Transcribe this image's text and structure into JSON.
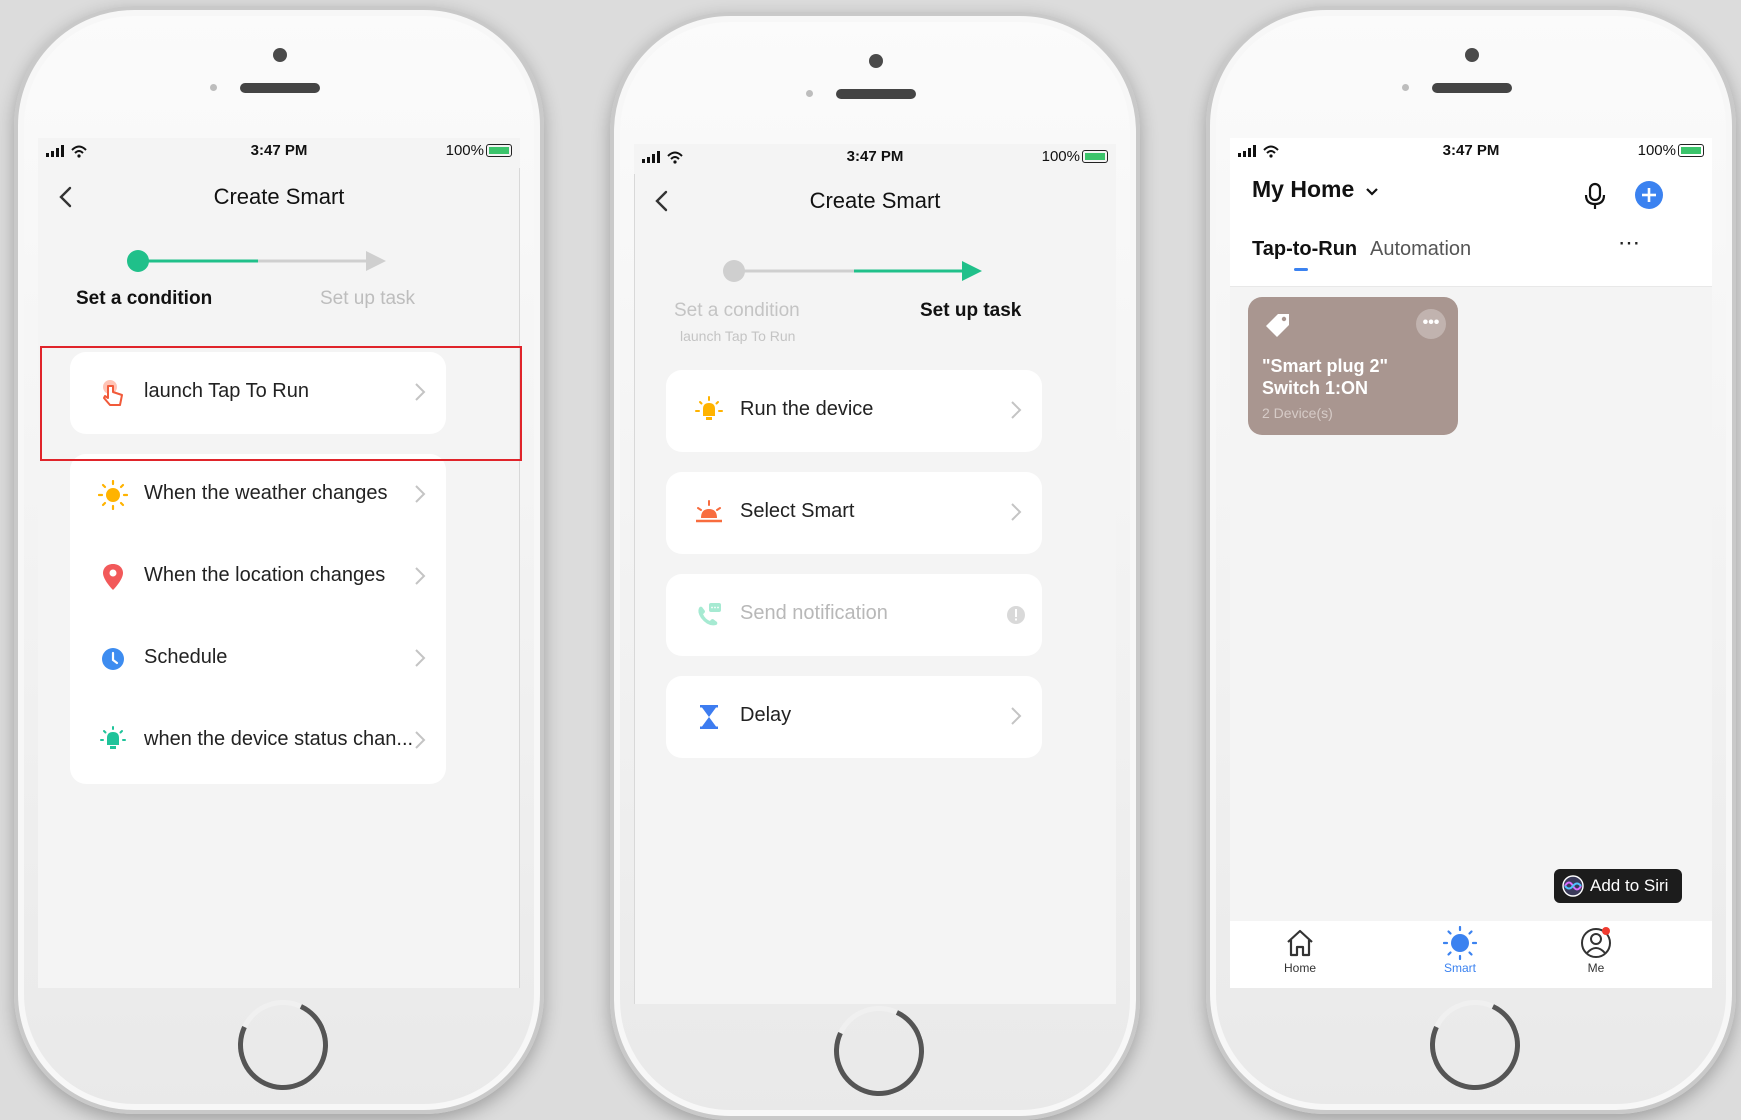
{
  "phones": [
    {
      "status": {
        "time": "3:47 PM",
        "battery": "100%"
      },
      "title": "Create Smart",
      "steps": {
        "step1": "Set a condition",
        "step2": "Set up task"
      },
      "highlighted_item": {
        "label": "launch Tap To Run",
        "icon": "tap-hand-icon"
      },
      "items": [
        {
          "label": "When the weather changes",
          "icon": "sun-icon"
        },
        {
          "label": "When the location changes",
          "icon": "location-pin-icon"
        },
        {
          "label": "Schedule",
          "icon": "clock-icon"
        },
        {
          "label": "when the device status chan...",
          "icon": "device-bulb-icon"
        }
      ],
      "colors": {
        "accent": "#20c08a",
        "highlight": "#e0242a"
      }
    },
    {
      "status": {
        "time": "3:47 PM",
        "battery": "100%"
      },
      "title": "Create Smart",
      "steps": {
        "step1": "Set a condition",
        "step1_sub": "launch Tap To Run",
        "step2": "Set up task"
      },
      "items": [
        {
          "label": "Run the device",
          "icon": "bulb-icon"
        },
        {
          "label": "Select Smart",
          "icon": "sunrise-icon"
        },
        {
          "label": "Send notification",
          "icon": "phone-message-icon",
          "disabled": true
        },
        {
          "label": "Delay",
          "icon": "hourglass-icon"
        }
      ]
    },
    {
      "status": {
        "time": "3:47 PM",
        "battery": "100%"
      },
      "home_name": "My Home",
      "tabs": [
        "Tap-to-Run",
        "Automation"
      ],
      "scene_card": {
        "title": "\"Smart plug 2\" Switch 1:ON",
        "subtitle": "2 Device(s)",
        "color": "#a99690"
      },
      "siri_button": "Add to Siri",
      "bottom_nav": [
        "Home",
        "Smart",
        "Me"
      ],
      "colors": {
        "accent": "#3b82f0"
      }
    }
  ]
}
